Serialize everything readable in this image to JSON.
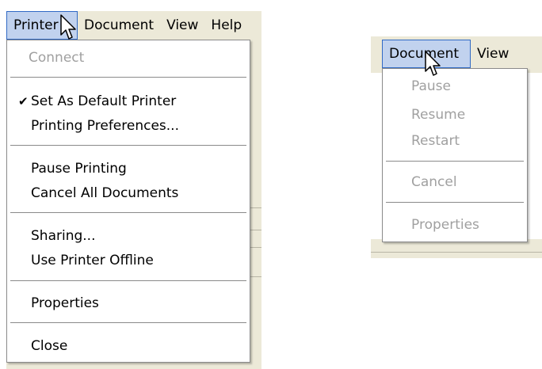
{
  "left_menu": {
    "menubar": [
      "Printer",
      "Document",
      "View",
      "Help"
    ],
    "items": [
      {
        "label": "Connect",
        "enabled": false,
        "checked": false
      },
      {
        "label": "Set As Default Printer",
        "enabled": true,
        "checked": true
      },
      {
        "label": "Printing Preferences...",
        "enabled": true,
        "checked": false
      },
      {
        "label": "Pause Printing",
        "enabled": true,
        "checked": false
      },
      {
        "label": "Cancel All Documents",
        "enabled": true,
        "checked": false
      },
      {
        "label": "Sharing...",
        "enabled": true,
        "checked": false
      },
      {
        "label": "Use Printer Offline",
        "enabled": true,
        "checked": false
      },
      {
        "label": "Properties",
        "enabled": true,
        "checked": false
      },
      {
        "label": "Close",
        "enabled": true,
        "checked": false
      }
    ],
    "check_glyph": "✔"
  },
  "right_menu": {
    "menubar": [
      "Document",
      "View"
    ],
    "items": [
      {
        "label": "Pause",
        "enabled": false
      },
      {
        "label": "Resume",
        "enabled": false
      },
      {
        "label": "Restart",
        "enabled": false
      },
      {
        "label": "Cancel",
        "enabled": false
      },
      {
        "label": "Properties",
        "enabled": false
      }
    ]
  },
  "colors": {
    "menubar_bg": "#ece9d8",
    "highlight_bg": "#c1d2ee",
    "highlight_border": "#316ac5",
    "disabled_text": "#a0a0a0"
  },
  "icons": [
    "mouse-pointer-icon",
    "checkmark-icon"
  ]
}
